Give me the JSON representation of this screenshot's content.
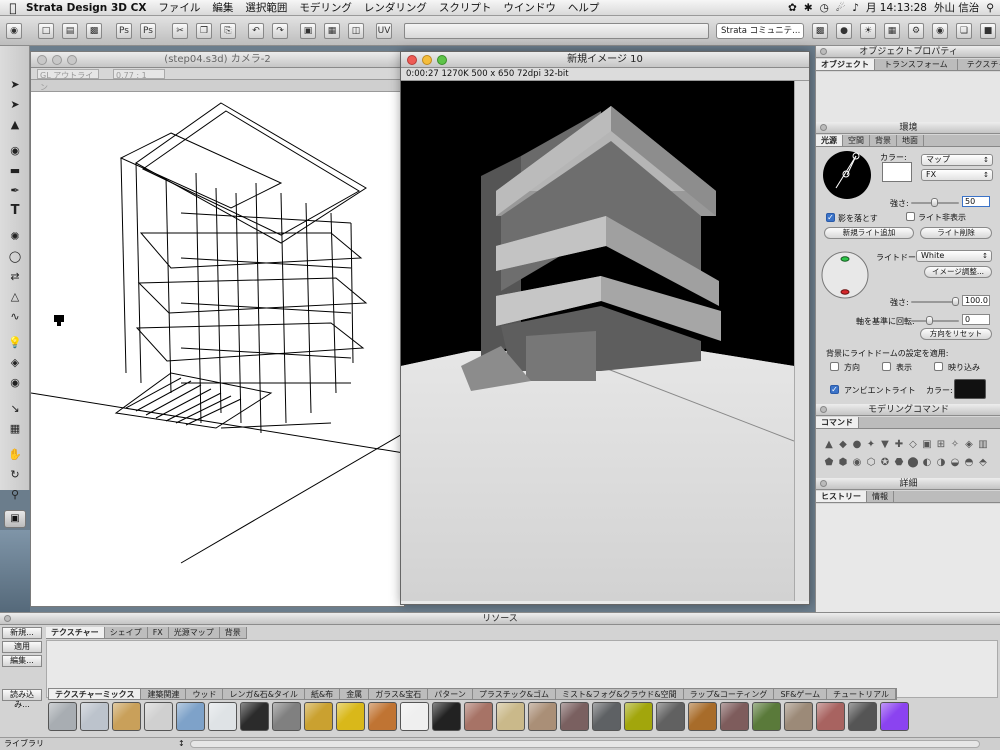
{
  "menubar": {
    "app_name": "Strata Design 3D CX",
    "items": [
      "ファイル",
      "編集",
      "選択範囲",
      "モデリング",
      "レンダリング",
      "スクリプト",
      "ウインドウ",
      "ヘルプ"
    ],
    "clock": "月 14:13:28",
    "user": "外山 信治"
  },
  "toolbar": {
    "community": "Strata コミュニテ..."
  },
  "modeling_window": {
    "title": "(step04.s3d) カメラ-2",
    "render_mode": "GL アウトライン",
    "zoom": "0.77 : 1"
  },
  "render_window": {
    "title": "新規イメージ 10",
    "info": "0:00:27  1270K  500 x 650  72dpi  32-bit"
  },
  "object_panel": {
    "title": "オブジェクトプロパティ",
    "tabs": [
      "オブジェクト",
      "トランスフォーム",
      "テクスチャー"
    ]
  },
  "environment_panel": {
    "title": "環境",
    "tabs": [
      "光源",
      "空間",
      "背景",
      "地面"
    ],
    "color_label": "カラー:",
    "map_select": "マップ",
    "fx_select": "FX",
    "intensity_label": "強さ:",
    "intensity_value": "50",
    "cast_shadow": "影を落とす",
    "hide_light": "ライト非表示",
    "add_light": "新規ライト追加",
    "delete_light": "ライト削除",
    "dome_label": "ライトドーム:",
    "dome_select": "White",
    "image_adjust": "イメージ調整...",
    "dome_intensity_label": "強さ:",
    "dome_intensity_value": "100.0",
    "rotate_label": "軸を基準に回転:",
    "rotate_value": "0",
    "reset_dir": "方向をリセット",
    "apply_label": "背景にライトドームの設定を適用:",
    "apply_options": [
      "方向",
      "表示",
      "映り込み"
    ],
    "ambient_label": "アンビエントライト",
    "ambient_color_label": "カラー:"
  },
  "modeling_command_panel": {
    "title": "モデリングコマンド",
    "tab": "コマンド",
    "icons": [
      "▲",
      "◆",
      "●",
      "✦",
      "▼",
      "✚",
      "◇",
      "▣",
      "⊞",
      "✧",
      "◈",
      "▥",
      "⬟",
      "⬢",
      "◉",
      "⬡",
      "✪",
      "⬣",
      "⬤",
      "◐",
      "◑",
      "◒",
      "◓",
      "⬘"
    ]
  },
  "detail_panel": {
    "title": "詳細",
    "tabs": [
      "ヒストリー",
      "情報"
    ]
  },
  "resource_panel": {
    "title": "リソース",
    "side_buttons": [
      "新規...",
      "適用",
      "編集...",
      "読み込み..."
    ],
    "tabs": [
      "テクスチャー",
      "シェイプ",
      "FX",
      "光源マップ",
      "背景"
    ],
    "library_tabs": [
      "テクスチャーミックス",
      "建築関連",
      "ウッド",
      "レンガ&石&タイル",
      "紙&布",
      "金属",
      "ガラス&宝石",
      "パターン",
      "プラスチック&ゴム",
      "ミスト&フォグ&クラウド&空間",
      "ラップ&コーティング",
      "SF&ゲーム",
      "チュートリアル"
    ],
    "library_menu": "ライブラリ",
    "material_colors": [
      "#a8adb2",
      "#bcc3cc",
      "#c9a05a",
      "#d0d0d0",
      "#7ea2c9",
      "#dfe3e6",
      "#2b2b2b",
      "#808080",
      "#caa130",
      "#d9b81a",
      "#c07433",
      "#efefef",
      "#222222",
      "#a77366",
      "#cab98a",
      "#aa8f77",
      "#7a6060",
      "#5e6164",
      "#a2a60c",
      "#616161",
      "#a86c2a",
      "#7e5c5c",
      "#5a7a3a",
      "#9c8a78",
      "#a86360",
      "#555555",
      "#8b43f0"
    ]
  },
  "colors": {
    "accent": "#3b73c8",
    "dome_green": "#2fc64a",
    "dome_red": "#d4262a"
  }
}
